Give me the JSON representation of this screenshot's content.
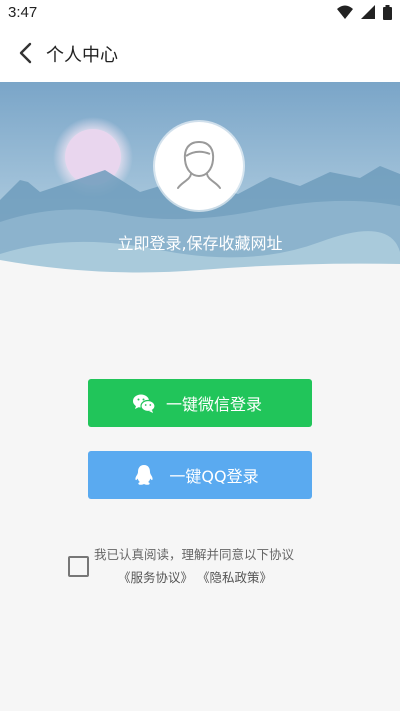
{
  "status_bar": {
    "time": "3:47",
    "icons": [
      "wifi-icon",
      "signal-icon",
      "battery-icon"
    ]
  },
  "app_bar": {
    "title": "个人中心",
    "back_icon": "back-arrow-icon"
  },
  "hero": {
    "prompt": "立即登录,保存收藏网址",
    "avatar_icon": "user-avatar-icon",
    "colors": {
      "sky_top": "#7aa5c8",
      "sky_bottom": "#c7dde9",
      "moon": "#e8d5ef"
    }
  },
  "buttons": {
    "wechat": {
      "label": "一键微信登录",
      "icon": "wechat-icon",
      "color": "#21c55a"
    },
    "qq": {
      "label": "一键QQ登录",
      "icon": "qq-icon",
      "color": "#5aaaf0"
    }
  },
  "agreement": {
    "line1": "我已认真阅读，理解并同意以下协议",
    "service_link": "《服务协议》",
    "privacy_link": "《隐私政策》",
    "checked": false
  }
}
